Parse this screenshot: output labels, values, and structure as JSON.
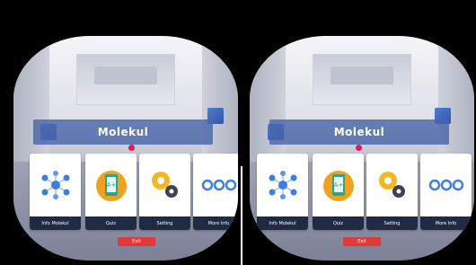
{
  "scene": {
    "title": "Molekul",
    "menu_items": [
      {
        "label": "Info Molekul",
        "icon": "molecule-icon"
      },
      {
        "label": "Quiz",
        "icon": "quiz-phone-icon"
      },
      {
        "label": "Setting",
        "icon": "gears-icon"
      },
      {
        "label": "More Info",
        "icon": "more-dots-icon"
      }
    ],
    "exit_label": "Exit"
  },
  "colors": {
    "banner": "#4a65aa",
    "pointer": "#e2195c",
    "card_label_bar": "#1f2a44",
    "exit_button": "#e23a3a",
    "molecule_blue": "#3d7fe0",
    "quiz_orange": "#f2a11f",
    "gear_yellow": "#f2b820",
    "gear_dark": "#3f4250"
  }
}
